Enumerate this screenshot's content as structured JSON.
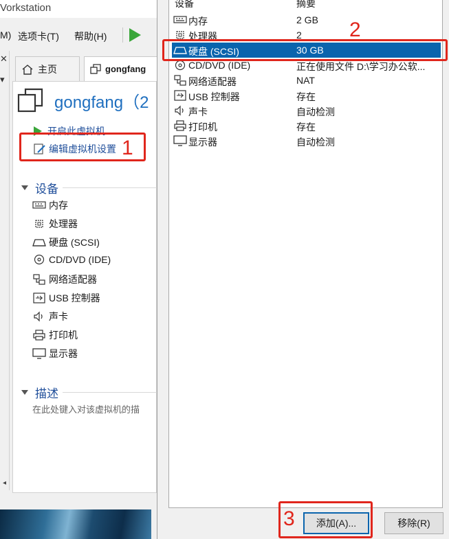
{
  "background_window": {
    "title_fragment": "Vorkstation",
    "menu": [
      "M)",
      "选项卡(T)",
      "帮助(H)"
    ],
    "tabs": {
      "home": "主页",
      "vm": "gongfang"
    },
    "vm_title": "gongfang（2",
    "actions": {
      "power_on": "开启此虚拟机",
      "edit_settings": "编辑虚拟机设置"
    },
    "devices_section": "设备",
    "devices": [
      {
        "icon": "memory-icon",
        "label": "内存"
      },
      {
        "icon": "cpu-icon",
        "label": "处理器"
      },
      {
        "icon": "disk-icon",
        "label": "硬盘 (SCSI)"
      },
      {
        "icon": "cd-icon",
        "label": "CD/DVD (IDE)"
      },
      {
        "icon": "network-icon",
        "label": "网络适配器"
      },
      {
        "icon": "usb-icon",
        "label": "USB 控制器"
      },
      {
        "icon": "speaker-icon",
        "label": "声卡"
      },
      {
        "icon": "printer-icon",
        "label": "打印机"
      },
      {
        "icon": "monitor-icon",
        "label": "显示器"
      }
    ],
    "description_section": "描述",
    "description_hint": "在此处键入对该虚拟机的描"
  },
  "dialog": {
    "columns": {
      "device": "设备",
      "summary": "摘要"
    },
    "rows": [
      {
        "icon": "memory-icon",
        "device": "内存",
        "summary": "2 GB",
        "selected": false
      },
      {
        "icon": "cpu-icon",
        "device": "处理器",
        "summary": "2",
        "selected": false
      },
      {
        "icon": "disk-icon",
        "device": "硬盘 (SCSI)",
        "summary": "30 GB",
        "selected": true
      },
      {
        "icon": "cd-icon",
        "device": "CD/DVD (IDE)",
        "summary": "正在使用文件 D:\\学习办公软...",
        "selected": false
      },
      {
        "icon": "network-icon",
        "device": "网络适配器",
        "summary": "NAT",
        "selected": false
      },
      {
        "icon": "usb-icon",
        "device": "USB 控制器",
        "summary": "存在",
        "selected": false
      },
      {
        "icon": "speaker-icon",
        "device": "声卡",
        "summary": "自动检测",
        "selected": false
      },
      {
        "icon": "printer-icon",
        "device": "打印机",
        "summary": "存在",
        "selected": false
      },
      {
        "icon": "monitor-icon",
        "device": "显示器",
        "summary": "自动检测",
        "selected": false
      }
    ],
    "buttons": {
      "add": "添加(A)...",
      "remove": "移除(R)"
    }
  },
  "annotations": {
    "step1": "1",
    "step2": "2",
    "step3": "3",
    "color": "#e0261c"
  },
  "colors": {
    "selection": "#0a64ad",
    "link": "#1f4e9a",
    "vm_title": "#1f6fbf"
  }
}
